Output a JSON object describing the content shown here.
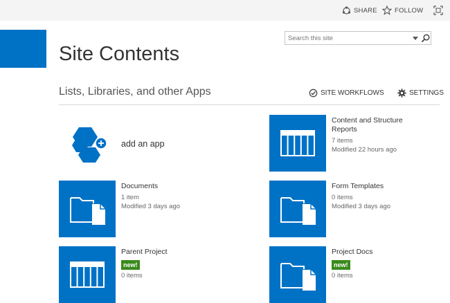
{
  "topbar": {
    "share_label": "SHARE",
    "follow_label": "FOLLOW",
    "share_icon": "share-icon",
    "follow_icon": "star-icon",
    "focus_icon": "focus-icon"
  },
  "header": {
    "title": "Site Contents",
    "search": {
      "placeholder": "Search this site",
      "value": ""
    }
  },
  "section": {
    "heading": "Lists, Libraries, and other Apps",
    "site_workflows_label": "SITE WORKFLOWS",
    "settings_label": "SETTINGS"
  },
  "add_app": {
    "label": "add an app",
    "icon": "add-app-icon"
  },
  "apps": [
    {
      "title": "Content and Structure Reports",
      "title_line1": "Content and Structure",
      "title_line2": "Reports",
      "items": "7 items",
      "modified": "Modified 22 hours ago",
      "icon": "list-icon",
      "new": ""
    },
    {
      "title": "Documents",
      "items": "1 item",
      "modified": "Modified 3 days ago",
      "icon": "library-icon",
      "new": ""
    },
    {
      "title": "Form Templates",
      "items": "0 items",
      "modified": "Modified 3 days ago",
      "icon": "library-icon",
      "new": ""
    },
    {
      "title": "Parent Project",
      "items": "0 items",
      "modified": "",
      "icon": "list-icon",
      "new": "new!"
    },
    {
      "title": "Project Docs",
      "items": "0 items",
      "modified": "",
      "icon": "library-icon",
      "new": "new!"
    }
  ],
  "colors": {
    "accent": "#0072c6",
    "new_badge": "#3a8a1c",
    "topbar": "#f4f4f4"
  }
}
